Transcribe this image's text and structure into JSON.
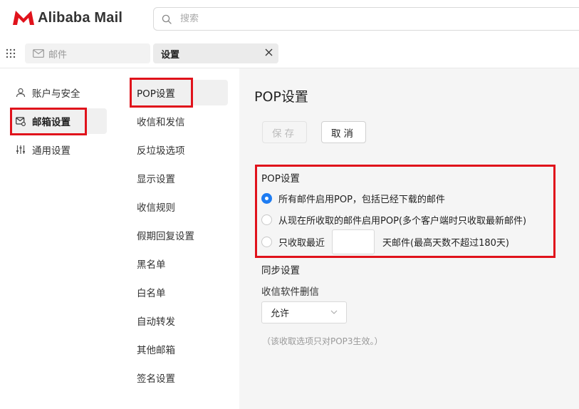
{
  "app": {
    "logo_text": "Alibaba Mail",
    "brand_color": "#e0121b"
  },
  "search": {
    "placeholder": "搜索",
    "icon": "search-icon"
  },
  "tabs": [
    {
      "label": "邮件",
      "icon": "mail-icon",
      "active": false
    },
    {
      "label": "设置",
      "active": true,
      "closable": true,
      "close_icon": "close-icon"
    }
  ],
  "left_nav": {
    "items": [
      {
        "label": "账户与安全",
        "icon": "user-icon",
        "active": false
      },
      {
        "label": "邮箱设置",
        "icon": "mailbox-settings-icon",
        "active": true
      },
      {
        "label": "通用设置",
        "icon": "sliders-icon",
        "active": false
      }
    ]
  },
  "mid_nav": {
    "items": [
      {
        "label": "POP设置",
        "active": true
      },
      {
        "label": "收信和发信"
      },
      {
        "label": "反垃圾选项"
      },
      {
        "label": "显示设置"
      },
      {
        "label": "收信规则"
      },
      {
        "label": "假期回复设置"
      },
      {
        "label": "黑名单"
      },
      {
        "label": "白名单"
      },
      {
        "label": "自动转发"
      },
      {
        "label": "其他邮箱"
      },
      {
        "label": "签名设置"
      }
    ]
  },
  "content": {
    "title": "POP设置",
    "buttons": {
      "save": "保存",
      "cancel": "取消"
    },
    "pop_section": {
      "title": "POP设置",
      "options": [
        {
          "label": "所有邮件启用POP，包括已经下载的邮件",
          "checked": true
        },
        {
          "label": "从现在所收取的邮件启用POP(多个客户端时只收取最新邮件)",
          "checked": false
        },
        {
          "label_before": "只收取最近",
          "value": "",
          "label_after": "天邮件(最高天数不超过180天)",
          "checked": false
        }
      ]
    },
    "sync_section": {
      "title": "同步设置",
      "delete_label": "收信软件删信",
      "delete_value": "允许",
      "hint": "（该收取选项只对POP3生效。）"
    }
  },
  "colors": {
    "accent": "#1e7cf2",
    "highlight": "#e0121b",
    "content_bg": "#f5f5f5"
  }
}
